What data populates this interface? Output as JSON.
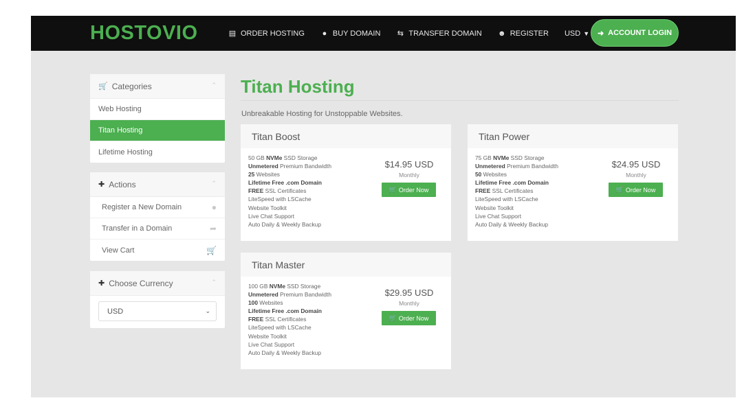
{
  "brand": {
    "logo_text": "HOSTOVIO",
    "accent": "#4caf50",
    "header_bg": "#0f0f0f"
  },
  "nav": {
    "items": [
      {
        "label": "ORDER HOSTING",
        "icon": "server-icon"
      },
      {
        "label": "BUY DOMAIN",
        "icon": "globe-icon"
      },
      {
        "label": "TRANSFER DOMAIN",
        "icon": "transfer-icon"
      },
      {
        "label": "REGISTER",
        "icon": "user-plus-icon"
      },
      {
        "label": "USD",
        "icon": "caret-down-icon"
      }
    ],
    "login_label": "ACCOUNT LOGIN"
  },
  "sidebar": {
    "categories": {
      "title": "Categories",
      "items": [
        {
          "label": "Web Hosting",
          "active": false
        },
        {
          "label": "Titan Hosting",
          "active": true
        },
        {
          "label": "Lifetime Hosting",
          "active": false
        }
      ]
    },
    "actions": {
      "title": "Actions",
      "items": [
        {
          "label": "Register a New Domain",
          "icon": "globe-icon"
        },
        {
          "label": "Transfer in a Domain",
          "icon": "share-icon"
        },
        {
          "label": "View Cart",
          "icon": "cart-icon"
        }
      ]
    },
    "currency": {
      "title": "Choose Currency",
      "selected": "USD"
    }
  },
  "main": {
    "title": "Titan Hosting",
    "tagline": "Unbreakable Hosting for Unstoppable Websites.",
    "products": [
      {
        "name": "Titan Boost",
        "price": "$14.95 USD",
        "cycle": "Monthly",
        "button": "Order Now",
        "features": [
          {
            "bold": "",
            "pre": "50 GB ",
            "b": "NVMe",
            "post": " SSD Storage"
          },
          {
            "pre": "",
            "b": "Unmetered",
            "post": " Premium Bandwidth"
          },
          {
            "pre": "",
            "b": "25",
            "post": " Websites"
          },
          {
            "pre": "",
            "b": "Lifetime Free .com Domain",
            "post": ""
          },
          {
            "pre": "",
            "b": "FREE",
            "post": " SSL Certificates"
          },
          {
            "pre": "LiteSpeed with LSCache",
            "b": "",
            "post": ""
          },
          {
            "pre": "Website Toolkit",
            "b": "",
            "post": ""
          },
          {
            "pre": "Live Chat Support",
            "b": "",
            "post": ""
          },
          {
            "pre": "Auto Daily & Weekly Backup",
            "b": "",
            "post": ""
          }
        ]
      },
      {
        "name": "Titan Power",
        "price": "$24.95 USD",
        "cycle": "Monthly",
        "button": "Order Now",
        "features": [
          {
            "pre": "75 GB ",
            "b": "NVMe",
            "post": " SSD Storage"
          },
          {
            "pre": "",
            "b": "Unmetered",
            "post": " Premium Bandwidth"
          },
          {
            "pre": "",
            "b": "50",
            "post": " Websites"
          },
          {
            "pre": "",
            "b": "Lifetime Free .com Domain",
            "post": ""
          },
          {
            "pre": "",
            "b": "FREE",
            "post": " SSL Certificates"
          },
          {
            "pre": "LiteSpeed with LSCache",
            "b": "",
            "post": ""
          },
          {
            "pre": "Website Toolkit",
            "b": "",
            "post": ""
          },
          {
            "pre": "Live Chat Support",
            "b": "",
            "post": ""
          },
          {
            "pre": "Auto Daily & Weekly Backup",
            "b": "",
            "post": ""
          }
        ]
      },
      {
        "name": "Titan Master",
        "price": "$29.95 USD",
        "cycle": "Monthly",
        "button": "Order Now",
        "features": [
          {
            "pre": "100 GB ",
            "b": "NVMe",
            "post": " SSD Storage"
          },
          {
            "pre": "",
            "b": "Unmetered",
            "post": " Premium Bandwidth"
          },
          {
            "pre": "",
            "b": "100",
            "post": " Websites"
          },
          {
            "pre": "",
            "b": "Lifetime Free .com Domain",
            "post": ""
          },
          {
            "pre": "",
            "b": "FREE",
            "post": " SSL Certificates"
          },
          {
            "pre": "LiteSpeed with LSCache",
            "b": "",
            "post": ""
          },
          {
            "pre": "Website Toolkit",
            "b": "",
            "post": ""
          },
          {
            "pre": "Live Chat Support",
            "b": "",
            "post": ""
          },
          {
            "pre": "Auto Daily & Weekly Backup",
            "b": "",
            "post": ""
          }
        ]
      }
    ]
  }
}
